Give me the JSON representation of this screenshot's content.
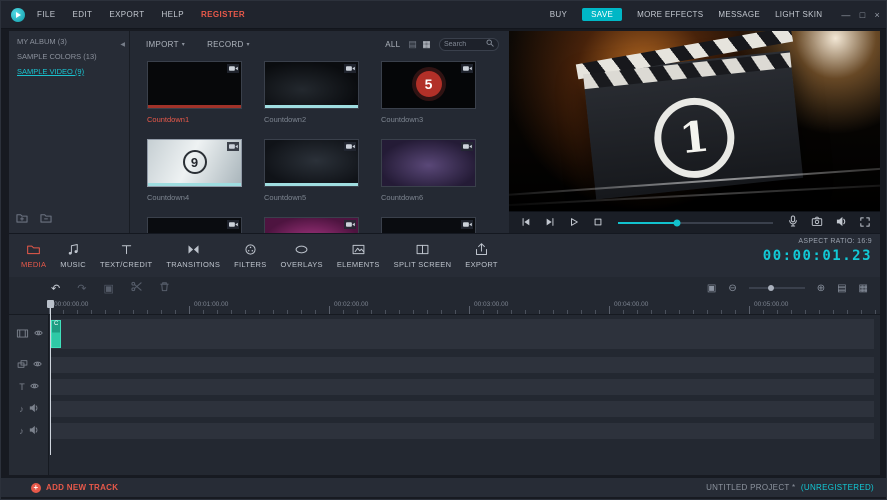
{
  "titlebar": {
    "menu": [
      "FILE",
      "EDIT",
      "EXPORT",
      "HELP",
      "REGISTER"
    ],
    "right": {
      "buy": "BUY",
      "save": "SAVE",
      "more_effects": "MORE EFFECTS",
      "message": "MESSAGE",
      "light_skin": "LIGHT SKIN"
    },
    "window_controls": {
      "minimize": "—",
      "maximize": "□",
      "close": "×"
    }
  },
  "sidebar": {
    "items": [
      {
        "label": "MY ALBUM (3)"
      },
      {
        "label": "SAMPLE COLORS (13)"
      },
      {
        "label": "SAMPLE VIDEO (9)"
      }
    ]
  },
  "library": {
    "import_label": "IMPORT",
    "record_label": "RECORD",
    "all_label": "ALL",
    "search_placeholder": "Search",
    "items": [
      {
        "name": "Countdown1"
      },
      {
        "name": "Countdown2"
      },
      {
        "name": "Countdown3",
        "number": "5"
      },
      {
        "name": "Countdown4",
        "number": "9"
      },
      {
        "name": "Countdown5"
      },
      {
        "name": "Countdown6"
      }
    ]
  },
  "preview": {
    "countdown_number": "1"
  },
  "tabs": [
    {
      "label": "MEDIA"
    },
    {
      "label": "MUSIC"
    },
    {
      "label": "TEXT/CREDIT"
    },
    {
      "label": "TRANSITIONS"
    },
    {
      "label": "FILTERS"
    },
    {
      "label": "OVERLAYS"
    },
    {
      "label": "ELEMENTS"
    },
    {
      "label": "SPLIT SCREEN"
    },
    {
      "label": "EXPORT"
    }
  ],
  "status": {
    "aspect_ratio": "ASPECT RATIO: 16:9",
    "timecode": "00:00:01.23"
  },
  "timeline": {
    "ruler": [
      "00:00:00.00",
      "00:01:00.00",
      "00:02:00.00",
      "00:03:00.00",
      "00:04:00.00",
      "00:05:00.00"
    ],
    "clip_label": "C",
    "track_text_icon": "T",
    "track_audio_icon": "♪"
  },
  "footer": {
    "add_track": "ADD NEW TRACK",
    "project": "UNTITLED PROJECT *",
    "registration": "(UNREGISTERED)"
  },
  "icons": {
    "undo": "↶",
    "redo": "↷",
    "caret": "▾",
    "collapse": "◀",
    "list_view": "▤",
    "grid_view": "▦",
    "zoom_in": "⊕",
    "zoom_out": "⊖",
    "marker": "▣",
    "layout_a": "▤",
    "layout_b": "▦"
  },
  "colors": {
    "accent_teal": "#12c9d6",
    "accent_red": "#e8594a"
  }
}
